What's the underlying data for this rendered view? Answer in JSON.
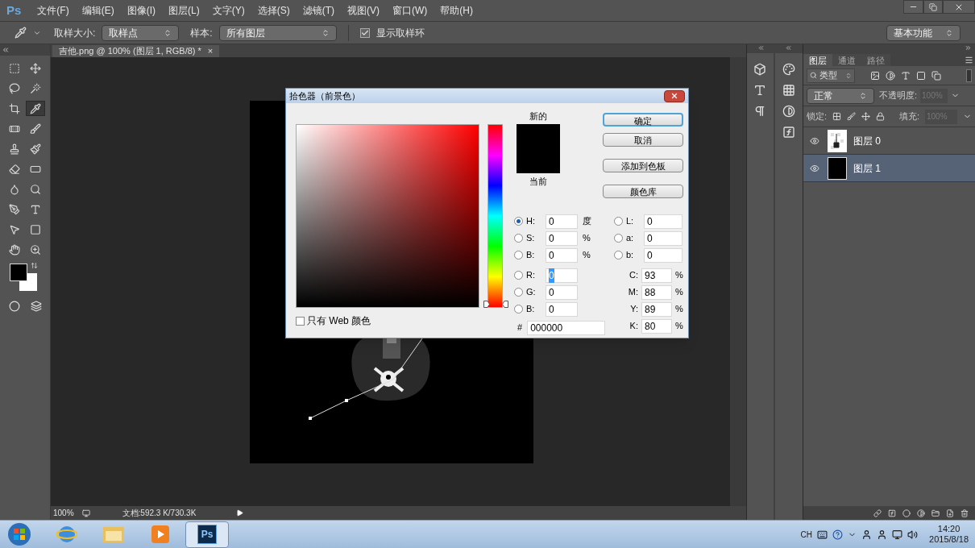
{
  "menu": {
    "logo": "Ps",
    "items": [
      "文件(F)",
      "编辑(E)",
      "图像(I)",
      "图层(L)",
      "文字(Y)",
      "选择(S)",
      "滤镜(T)",
      "视图(V)",
      "窗口(W)",
      "帮助(H)"
    ]
  },
  "options_bar": {
    "sample_size_label": "取样大小:",
    "sample_size": "取样点",
    "sample_label": "样本:",
    "sample": "所有图层",
    "show_ring": {
      "label": "显示取样环",
      "checked": true
    },
    "workspace": "基本功能"
  },
  "document_tab": {
    "title": "吉他.png @ 100% (图层 1, RGB/8) *",
    "close": "×"
  },
  "tools": [
    {
      "kind": "marquee",
      "selected": false
    },
    {
      "kind": "move",
      "selected": false
    },
    {
      "kind": "lasso",
      "selected": false
    },
    {
      "kind": "quick_select",
      "selected": false
    },
    {
      "kind": "crop",
      "selected": false
    },
    {
      "kind": "eyedropper",
      "selected": true
    },
    {
      "kind": "healing",
      "selected": false
    },
    {
      "kind": "brush",
      "selected": false
    },
    {
      "kind": "stamp",
      "selected": false
    },
    {
      "kind": "history_brush",
      "selected": false
    },
    {
      "kind": "eraser",
      "selected": false
    },
    {
      "kind": "gradient",
      "selected": false
    },
    {
      "kind": "blur",
      "selected": false
    },
    {
      "kind": "dodge",
      "selected": false
    },
    {
      "kind": "pen",
      "selected": false
    },
    {
      "kind": "type",
      "selected": false
    },
    {
      "kind": "path_select",
      "selected": false
    },
    {
      "kind": "shape",
      "selected": false
    },
    {
      "kind": "hand",
      "selected": false
    },
    {
      "kind": "zoom",
      "selected": false
    }
  ],
  "dialog": {
    "title": "拾色器（前景色）",
    "hue": {
      "level": 0
    },
    "new_label": "新的",
    "current_label": "当前",
    "buttons": [
      {
        "label": "确定",
        "default": true
      },
      {
        "label": "取消",
        "default": false
      },
      {
        "label": "添加到色板",
        "default": false
      },
      {
        "label": "颜色库",
        "default": false
      }
    ],
    "web_only": {
      "label": "只有 Web 颜色",
      "checked": false
    },
    "hsb": [
      {
        "label": "H:",
        "value": "0",
        "unit": "度",
        "selected": true,
        "highlighted": false
      },
      {
        "label": "S:",
        "value": "0",
        "unit": "%",
        "selected": false,
        "highlighted": false
      },
      {
        "label": "B:",
        "value": "0",
        "unit": "%",
        "selected": false,
        "highlighted": false
      }
    ],
    "rgb": [
      {
        "label": "R:",
        "value": "0",
        "selected": false,
        "highlighted": true
      },
      {
        "label": "G:",
        "value": "0",
        "selected": false,
        "highlighted": false
      },
      {
        "label": "B:",
        "value": "0",
        "selected": false,
        "highlighted": false
      }
    ],
    "hex": {
      "label": "#",
      "value": "000000"
    },
    "lab": [
      {
        "label": "L:",
        "value": "0",
        "selected": false
      },
      {
        "label": "a:",
        "value": "0",
        "selected": false
      },
      {
        "label": "b:",
        "value": "0",
        "selected": false
      }
    ],
    "cmyk": [
      {
        "label": "C:",
        "value": "93",
        "unit": "%"
      },
      {
        "label": "M:",
        "value": "88",
        "unit": "%"
      },
      {
        "label": "Y:",
        "value": "89",
        "unit": "%"
      },
      {
        "label": "K:",
        "value": "80",
        "unit": "%"
      }
    ]
  },
  "layers_panel": {
    "tabs": [
      {
        "label": "图层",
        "selected": true
      },
      {
        "label": "通道",
        "selected": false
      },
      {
        "label": "路径",
        "selected": false
      }
    ],
    "filter": "类型",
    "blend_mode": "正常",
    "opacity_label": "不透明度:",
    "opacity": "100%",
    "lock_label": "锁定:",
    "fill_label": "填充:",
    "fill": "100%",
    "layers": [
      {
        "name": "图层 0",
        "visible": true,
        "selected": false,
        "kind": "guitar"
      },
      {
        "name": "图层 1",
        "visible": true,
        "selected": true,
        "kind": "black"
      }
    ]
  },
  "status_bar": {
    "zoom": "100%",
    "doc_info": "文档:592.3 K/730.3K"
  },
  "taskbar": {
    "apps": [
      {
        "kind": "browser",
        "selected": false
      },
      {
        "kind": "folder",
        "selected": false
      },
      {
        "kind": "media",
        "selected": false
      },
      {
        "kind": "photoshop",
        "label": "Ps",
        "selected": true
      }
    ],
    "language": "CH",
    "time": "14:20",
    "date": "2015/8/18"
  }
}
